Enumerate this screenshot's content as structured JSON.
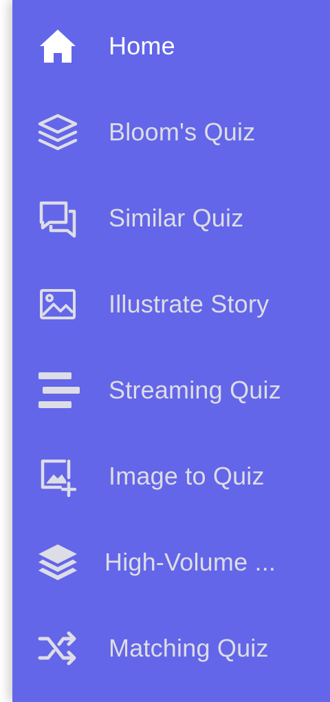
{
  "sidebar": {
    "background": "#6366e8",
    "active_text_color": "#ffffff",
    "inactive_text_color": "#dddde6",
    "items": [
      {
        "label": "Home",
        "icon": "home-icon",
        "active": true
      },
      {
        "label": "Bloom's Quiz",
        "icon": "layers-outline-icon",
        "active": false
      },
      {
        "label": "Similar Quiz",
        "icon": "chat-bubbles-icon",
        "active": false
      },
      {
        "label": "Illustrate Story",
        "icon": "image-icon",
        "active": false
      },
      {
        "label": "Streaming Quiz",
        "icon": "bars-icon",
        "active": false
      },
      {
        "label": "Image to Quiz",
        "icon": "image-add-icon",
        "active": false
      },
      {
        "label": "High-Volume ...",
        "icon": "layers-solid-icon",
        "active": false
      },
      {
        "label": "Matching Quiz",
        "icon": "shuffle-icon",
        "active": false
      }
    ]
  }
}
